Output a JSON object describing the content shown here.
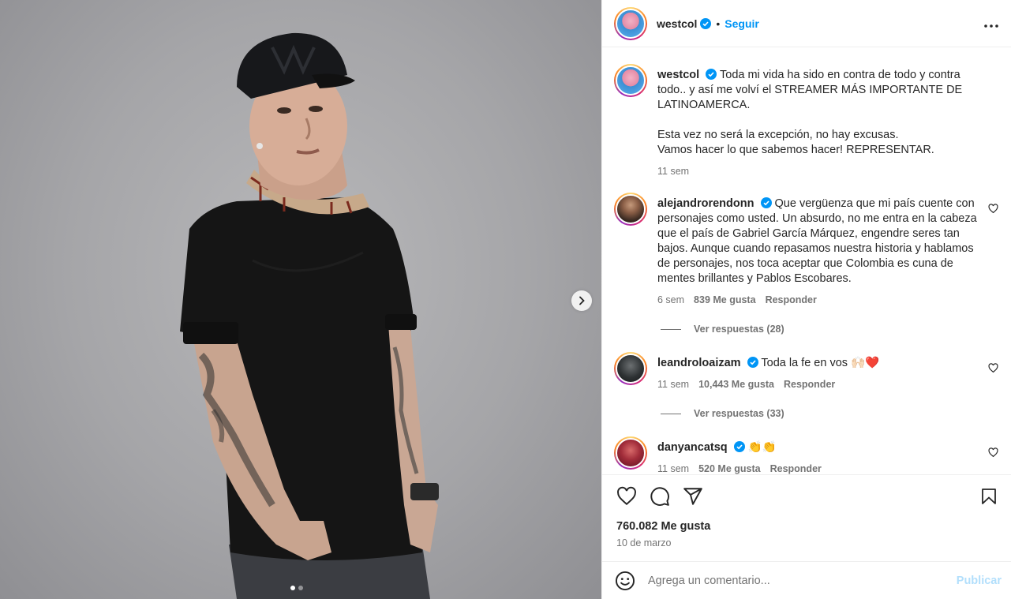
{
  "post": {
    "author": "westcol",
    "follow_label": "Seguir",
    "separator": "•",
    "more_label": "•••",
    "caption": {
      "username": "westcol",
      "text_line1": "Toda mi vida ha sido en contra de todo y contra todo.. y así me volví el STREAMER MÁS IMPORTANTE DE LATINOAMERCA.",
      "text_line2": "Esta vez no será la excepción, no hay excusas.",
      "text_line3": "Vamos hacer lo que sabemos hacer! REPRESENTAR.",
      "time": "11 sem"
    },
    "comments": [
      {
        "username": "alejandrorendonn",
        "text": "Que vergüenza que mi país cuente con personajes como usted. Un absurdo, no me entra en la cabeza que el país de Gabriel García Márquez, engendre seres tan bajos. Aunque cuando repasamos nuestra historia y hablamos de personajes, nos toca aceptar que Colombia es cuna de mentes brillantes y Pablos Escobares.",
        "time": "6 sem",
        "likes": "839 Me gusta",
        "reply": "Responder",
        "view_replies": "Ver respuestas (28)"
      },
      {
        "username": "leandroloaizam",
        "text": "Toda la fe en vos 🙌🏻❤️",
        "time": "11 sem",
        "likes": "10,443 Me gusta",
        "reply": "Responder",
        "view_replies": "Ver respuestas (33)"
      },
      {
        "username": "danyancatsq",
        "text": "👏👏",
        "time": "11 sem",
        "likes": "520 Me gusta",
        "reply": "Responder"
      }
    ],
    "likes_total": "760.082 Me gusta",
    "date": "10 de marzo",
    "add_comment_placeholder": "Agrega un comentario...",
    "publish_label": "Publicar",
    "carousel": {
      "current": 1,
      "total": 2
    },
    "colors": {
      "link": "#0095f6",
      "verified": "#0095f6",
      "publish_disabled": "#b2dffc",
      "secondary_text": "#737373"
    },
    "icons": [
      "verified-badge-icon",
      "more-icon",
      "heart-icon",
      "comment-icon",
      "share-icon",
      "bookmark-icon",
      "emoji-icon",
      "chevron-right-icon"
    ]
  }
}
